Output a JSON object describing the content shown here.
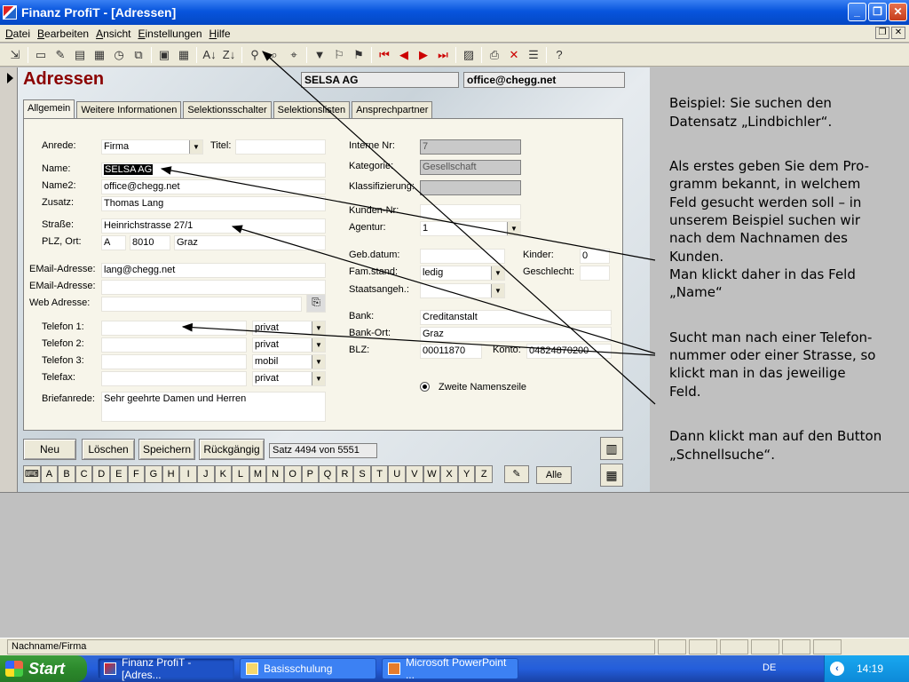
{
  "window": {
    "title": "Finanz ProfiT - [Adressen]"
  },
  "menu": [
    {
      "label": "Datei",
      "key": "D"
    },
    {
      "label": "Bearbeiten",
      "key": "B"
    },
    {
      "label": "Ansicht",
      "key": "A"
    },
    {
      "label": "Einstellungen",
      "key": "E"
    },
    {
      "label": "Hilfe",
      "key": "H"
    }
  ],
  "form": {
    "title": "Adressen",
    "header_name": "SELSA AG",
    "header_email": "office@chegg.net",
    "tabs": [
      "Allgemein",
      "Weitere Informationen",
      "Selektionsschalter",
      "Selektionslisten",
      "Ansprechpartner"
    ],
    "labels": {
      "anrede": "Anrede:",
      "titel": "Titel:",
      "name": "Name:",
      "name2": "Name2:",
      "zusatz": "Zusatz:",
      "strasse": "Straße:",
      "plz_ort": "PLZ, Ort:",
      "email1": "EMail-Adresse:",
      "email2": "EMail-Adresse:",
      "web": "Web Adresse:",
      "tel1": "Telefon 1:",
      "tel2": "Telefon 2:",
      "tel3": "Telefon 3:",
      "telefax": "Telefax:",
      "briefanrede": "Briefanrede:",
      "interne_nr": "Interne Nr:",
      "kategorie": "Kategorie:",
      "klassifizierung": "Klassifizierung:",
      "kunden_nr": "Kunden-Nr:",
      "agentur": "Agentur:",
      "geb_datum": "Geb.datum:",
      "kinder": "Kinder:",
      "fam_stand": "Fam.stand:",
      "geschlecht": "Geschlecht:",
      "staatsangeh": "Staatsangeh.:",
      "bank": "Bank:",
      "bank_ort": "Bank-Ort:",
      "blz": "BLZ:",
      "konto": "Konto:",
      "zweite_namenszeile": "Zweite Namenszeile"
    },
    "values": {
      "anrede": "Firma",
      "titel": "",
      "name": "SELSA AG",
      "name2": "office@chegg.net",
      "zusatz": "Thomas Lang",
      "strasse": "Heinrichstrasse 27/1",
      "land": "A",
      "plz": "8010",
      "ort": "Graz",
      "email1": "lang@chegg.net",
      "email2": "",
      "web": "",
      "tel1": "",
      "tel1_type": "privat",
      "tel2": "",
      "tel2_type": "privat",
      "tel3": "",
      "tel3_type": "mobil",
      "telefax": "",
      "telefax_type": "privat",
      "briefanrede": "Sehr geehrte Damen und Herren",
      "interne_nr": "7",
      "kategorie": "Gesellschaft",
      "klassifizierung": "",
      "kunden_nr": "",
      "agentur": "1",
      "geb_datum": "",
      "kinder": "0",
      "fam_stand": "ledig",
      "geschlecht": "",
      "staatsangeh": "",
      "bank": "Creditanstalt",
      "bank_ort": "Graz",
      "blz": "00011870",
      "konto": "04824870200"
    },
    "buttons": {
      "neu": "Neu",
      "loeschen": "Löschen",
      "speichern": "Speichern",
      "rueckgaengig": "Rückgängig"
    },
    "record_status": "Satz 4494 von 5551",
    "alphabet": [
      "A",
      "B",
      "C",
      "D",
      "E",
      "F",
      "G",
      "H",
      "I",
      "J",
      "K",
      "L",
      "M",
      "N",
      "O",
      "P",
      "Q",
      "R",
      "S",
      "T",
      "U",
      "V",
      "W",
      "X",
      "Y",
      "Z"
    ],
    "alle": "Alle"
  },
  "notes": {
    "p1": "Beispiel: Sie suchen den\nDatensatz „Lindbichler“.",
    "p2": "Als erstes geben Sie dem Pro-\ngramm bekannt, in welchem\nFeld gesucht werden soll – in\nunserem Beispiel suchen wir\nnach dem Nachnamen des\nKunden.\nMan klickt daher in das Feld\n„Name“",
    "p3": "Sucht man nach einer Telefon-\nnummer oder einer Strasse, so\nklickt man in das jeweilige\nFeld.",
    "p4": "Dann klickt man auf den Button\n„Schnellsuche“."
  },
  "statusbar": {
    "text": "Nachname/Firma"
  },
  "taskbar": {
    "start": "Start",
    "tasks": [
      "Finanz ProfiT - [Adres...",
      "Basisschulung",
      "Microsoft PowerPoint ..."
    ],
    "lang": "DE",
    "clock": "14:19"
  },
  "colors": {
    "form_title": "#8b0000",
    "titlebar": "#0855dd",
    "taskbar": "#245edb",
    "start": "#2c8a2c"
  }
}
